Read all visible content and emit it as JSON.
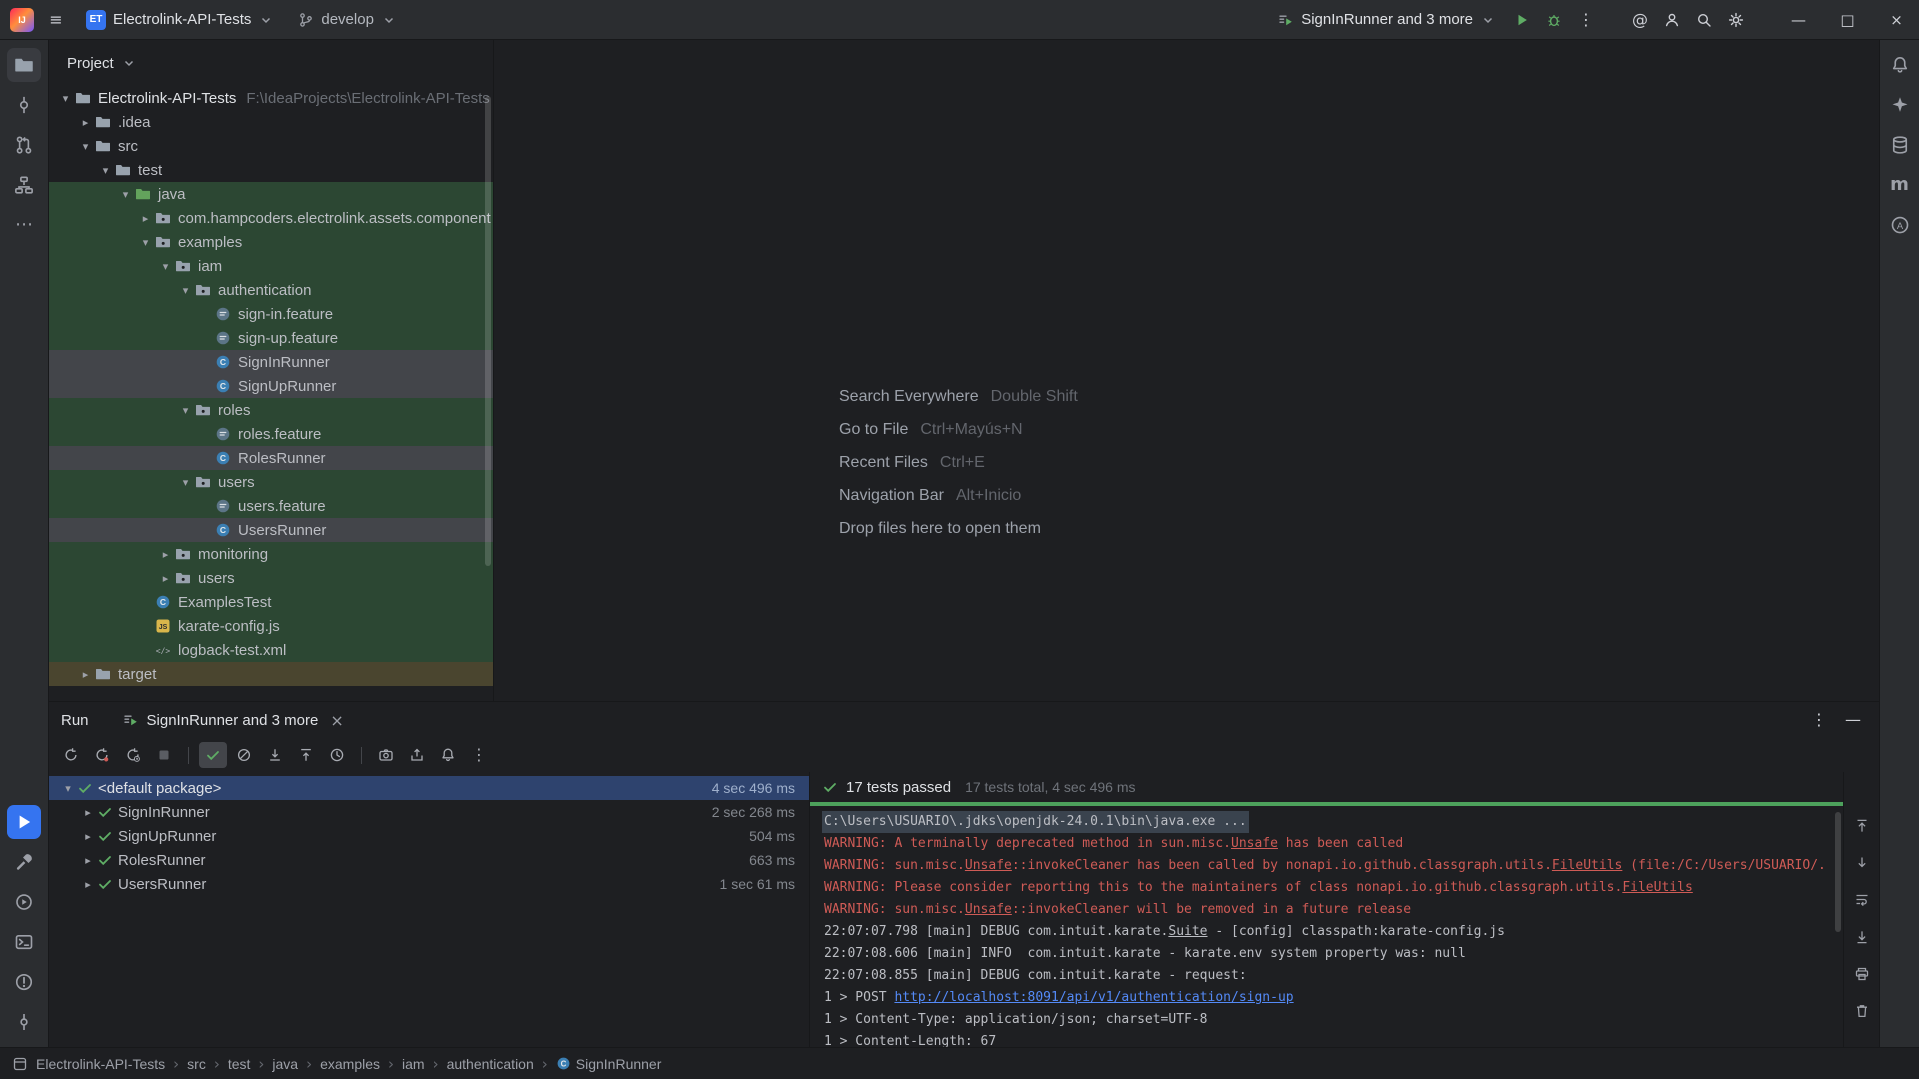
{
  "colors": {
    "accent_blue": "#3574F0",
    "test_source_green": "#2C4733",
    "pass_green": "#5FAD65",
    "warning_red": "#CF5B56",
    "link_blue": "#548AF7",
    "selection_blue": "#2E436E",
    "excluded_olive": "#4A452F"
  },
  "title_bar": {
    "project_abbrev": "ET",
    "project_name": "Electrolink-API-Tests",
    "branch": "develop",
    "run_config": "SignInRunner and 3 more",
    "minimize_glyph": "—",
    "maximize_glyph": "□",
    "close_glyph": "×"
  },
  "left_strip": {
    "top": [
      {
        "name": "project",
        "active": true
      },
      {
        "name": "commit"
      },
      {
        "name": "pull-requests"
      },
      {
        "name": "structure"
      },
      {
        "name": "more-tool-windows"
      }
    ],
    "bottom": [
      {
        "name": "run",
        "active_run": true
      },
      {
        "name": "build"
      },
      {
        "name": "services"
      },
      {
        "name": "terminal"
      },
      {
        "name": "problems"
      },
      {
        "name": "version-control"
      }
    ]
  },
  "right_strip": [
    {
      "name": "notifications"
    },
    {
      "name": "ai-assistant"
    },
    {
      "name": "database"
    },
    {
      "name": "maven"
    },
    {
      "name": "assistant"
    }
  ],
  "project_panel": {
    "title": "Project",
    "tree": [
      {
        "indent": 0,
        "chev": "open",
        "icon": "folder",
        "label": "Electrolink-API-Tests",
        "hint": "F:\\IdeaProjects\\Electrolink-API-Tests",
        "bg": "none",
        "root": true
      },
      {
        "indent": 1,
        "chev": "closed",
        "icon": "folder",
        "label": ".idea",
        "bg": "none"
      },
      {
        "indent": 1,
        "chev": "open",
        "icon": "folder",
        "label": "src",
        "bg": "none"
      },
      {
        "indent": 2,
        "chev": "open",
        "icon": "folder",
        "label": "test",
        "bg": "none"
      },
      {
        "indent": 3,
        "chev": "open",
        "icon": "folder-test",
        "label": "java",
        "bg": "green"
      },
      {
        "indent": 4,
        "chev": "closed",
        "icon": "package",
        "label": "com.hampcoders.electrolink.assets.component",
        "bg": "green"
      },
      {
        "indent": 4,
        "chev": "open",
        "icon": "package",
        "label": "examples",
        "bg": "green"
      },
      {
        "indent": 5,
        "chev": "open",
        "icon": "package",
        "label": "iam",
        "bg": "green"
      },
      {
        "indent": 6,
        "chev": "open",
        "icon": "package",
        "label": "authentication",
        "bg": "green"
      },
      {
        "indent": 7,
        "chev": "none",
        "icon": "feature",
        "label": "sign-in.feature",
        "bg": "green"
      },
      {
        "indent": 7,
        "chev": "none",
        "icon": "feature",
        "label": "sign-up.feature",
        "bg": "green"
      },
      {
        "indent": 7,
        "chev": "none",
        "icon": "class",
        "label": "SignInRunner",
        "bg": "selected"
      },
      {
        "indent": 7,
        "chev": "none",
        "icon": "class",
        "label": "SignUpRunner",
        "bg": "selected"
      },
      {
        "indent": 6,
        "chev": "open",
        "icon": "package",
        "label": "roles",
        "bg": "green"
      },
      {
        "indent": 7,
        "chev": "none",
        "icon": "feature",
        "label": "roles.feature",
        "bg": "green"
      },
      {
        "indent": 7,
        "chev": "none",
        "icon": "class",
        "label": "RolesRunner",
        "bg": "selected"
      },
      {
        "indent": 6,
        "chev": "open",
        "icon": "package",
        "label": "users",
        "bg": "green"
      },
      {
        "indent": 7,
        "chev": "none",
        "icon": "feature",
        "label": "users.feature",
        "bg": "green"
      },
      {
        "indent": 7,
        "chev": "none",
        "icon": "class",
        "label": "UsersRunner",
        "bg": "selected"
      },
      {
        "indent": 5,
        "chev": "closed",
        "icon": "package",
        "label": "monitoring",
        "bg": "green"
      },
      {
        "indent": 5,
        "chev": "closed",
        "icon": "package",
        "label": "users",
        "bg": "green"
      },
      {
        "indent": 4,
        "chev": "none",
        "icon": "class",
        "label": "ExamplesTest",
        "bg": "green"
      },
      {
        "indent": 4,
        "chev": "none",
        "icon": "js",
        "label": "karate-config.js",
        "bg": "green"
      },
      {
        "indent": 4,
        "chev": "none",
        "icon": "xml",
        "label": "logback-test.xml",
        "bg": "green"
      },
      {
        "indent": 1,
        "chev": "closed",
        "icon": "folder",
        "label": "target",
        "bg": "olive"
      }
    ]
  },
  "editor": {
    "shortcuts": [
      {
        "action": "Search Everywhere",
        "keys": "Double Shift"
      },
      {
        "action": "Go to File",
        "keys": "Ctrl+Mayús+N"
      },
      {
        "action": "Recent Files",
        "keys": "Ctrl+E"
      },
      {
        "action": "Navigation Bar",
        "keys": "Alt+Inicio"
      },
      {
        "action": "Drop files here to open them",
        "keys": ""
      }
    ]
  },
  "run_panel": {
    "title": "Run",
    "tab_label": "SignInRunner and 3 more",
    "tab_close_glyph": "×",
    "toolbar": [
      {
        "name": "rerun"
      },
      {
        "name": "rerun-failed-tests"
      },
      {
        "name": "toggle-auto-test"
      },
      {
        "name": "stop",
        "disabled": true
      },
      {
        "sep": true
      },
      {
        "name": "show-passed",
        "active": true
      },
      {
        "name": "show-ignored"
      },
      {
        "name": "expand-all"
      },
      {
        "name": "collapse-all"
      },
      {
        "name": "test-history"
      },
      {
        "sep": true
      },
      {
        "name": "screenshot"
      },
      {
        "name": "export-test-results"
      },
      {
        "name": "notifications"
      },
      {
        "name": "more-options"
      }
    ],
    "tests": [
      {
        "chev": "open",
        "name": "<default package>",
        "time": "4 sec 496 ms",
        "selected": true,
        "root": true
      },
      {
        "chev": "closed",
        "name": "SignInRunner",
        "time": "2 sec 268 ms"
      },
      {
        "chev": "closed",
        "name": "SignUpRunner",
        "time": "504 ms"
      },
      {
        "chev": "closed",
        "name": "RolesRunner",
        "time": "663 ms"
      },
      {
        "chev": "closed",
        "name": "UsersRunner",
        "time": "1 sec 61 ms"
      }
    ],
    "summary_passed": "17 tests passed",
    "summary_detail": "17 tests total, 4 sec 496 ms",
    "console_lines": [
      {
        "selected": true,
        "segments": [
          {
            "t": "C:\\Users\\USUARIO\\.jdks\\openjdk-24.0.1\\bin\\java.exe ...",
            "s": "plain"
          }
        ]
      },
      {
        "segments": [
          {
            "t": "WARNING: A terminally deprecated method in sun.misc.",
            "s": "warn"
          },
          {
            "t": "Unsafe",
            "s": "warn-u"
          },
          {
            "t": " has been called",
            "s": "warn"
          }
        ]
      },
      {
        "segments": [
          {
            "t": "WARNING: sun.misc.",
            "s": "warn"
          },
          {
            "t": "Unsafe",
            "s": "warn-u"
          },
          {
            "t": "::invokeCleaner has been called by nonapi.io.github.classgraph.utils.",
            "s": "warn"
          },
          {
            "t": "FileUtils",
            "s": "warn-u"
          },
          {
            "t": " (file:/C:/Users/USUARIO/.",
            "s": "warn"
          }
        ]
      },
      {
        "segments": [
          {
            "t": "WARNING: Please consider reporting this to the maintainers of class nonapi.io.github.classgraph.utils.",
            "s": "warn"
          },
          {
            "t": "FileUtils",
            "s": "warn-u"
          }
        ]
      },
      {
        "segments": [
          {
            "t": "WARNING: sun.misc.",
            "s": "warn"
          },
          {
            "t": "Unsafe",
            "s": "warn-u"
          },
          {
            "t": "::invokeCleaner will be removed in a future release",
            "s": "warn"
          }
        ]
      },
      {
        "segments": [
          {
            "t": "22:07:07.798 [main] DEBUG com.intuit.karate.",
            "s": "plain"
          },
          {
            "t": "Suite",
            "s": "plain-u"
          },
          {
            "t": " - [config] classpath:karate-config.js",
            "s": "plain"
          }
        ]
      },
      {
        "segments": [
          {
            "t": "22:07:08.606 [main] INFO  com.intuit.karate - karate.env system property was: null",
            "s": "plain"
          }
        ]
      },
      {
        "segments": [
          {
            "t": "22:07:08.855 [main] DEBUG com.intuit.karate - request:",
            "s": "plain"
          }
        ]
      },
      {
        "segments": [
          {
            "t": "1 > POST ",
            "s": "plain"
          },
          {
            "t": "http://localhost:8091/api/v1/authentication/sign-up",
            "s": "link"
          }
        ]
      },
      {
        "segments": [
          {
            "t": "1 > Content-Type: application/json; charset=UTF-8",
            "s": "plain"
          }
        ]
      },
      {
        "segments": [
          {
            "t": "1 > Content-Length: 67",
            "s": "plain"
          }
        ]
      }
    ],
    "console_side": [
      {
        "name": "scroll-up"
      },
      {
        "name": "scroll-down"
      },
      {
        "name": "soft-wrap"
      },
      {
        "name": "scroll-end"
      },
      {
        "name": "print"
      },
      {
        "name": "clear"
      }
    ]
  },
  "status_bar": {
    "breadcrumbs": [
      "Electrolink-API-Tests",
      "src",
      "test",
      "java",
      "examples",
      "iam",
      "authentication",
      "SignInRunner"
    ]
  }
}
